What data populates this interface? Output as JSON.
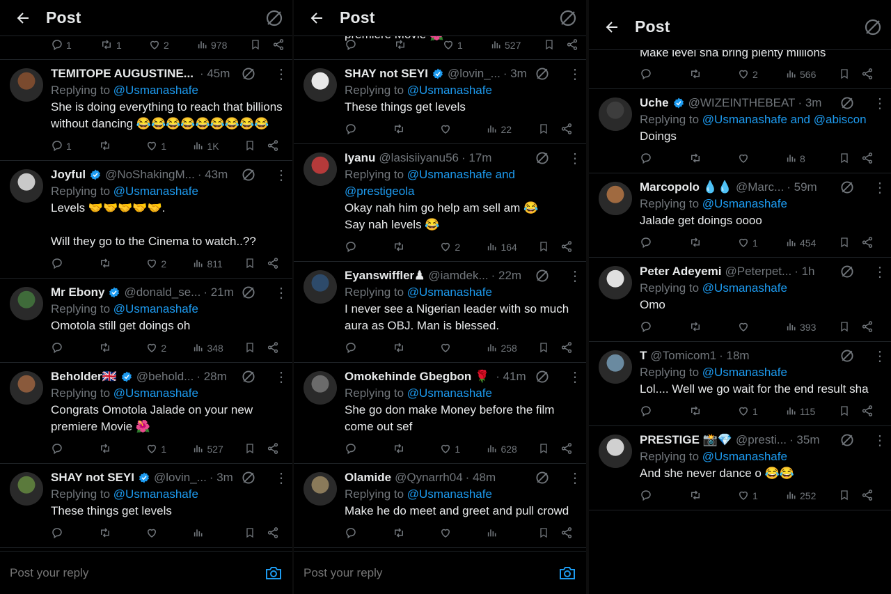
{
  "header": {
    "title": "Post"
  },
  "compose": {
    "placeholder": "Post your reply"
  },
  "colors": {
    "background": "#000000",
    "text": "#e7e9ea",
    "muted": "#71767b",
    "accent": "#1d9bf0"
  },
  "panels": [
    {
      "tail": {
        "text": "",
        "reply": "1",
        "retweets": "1",
        "likes": "2",
        "views": "978"
      },
      "tweets": [
        {
          "name": "TEMITOPE AUGUSTINE...",
          "verified": false,
          "handle": "",
          "time": "· 45m",
          "replying": "Replying to ",
          "mention": "@Usmanashafe",
          "text": "She is doing everything to reach that billions without dancing 😂😂😂😂😂😂😂😂😂",
          "reply": "1",
          "retweets": "",
          "likes": "1",
          "views": "1K"
        },
        {
          "name": "Joyful",
          "verified": true,
          "handle": "@NoShakingM...",
          "time": "· 43m",
          "replying": "Replying to ",
          "mention": "@Usmanashafe",
          "text": "Levels 🤝🤝🤝🤝🤝.\n\nWill they go to the Cinema to watch..??",
          "reply": "",
          "retweets": "",
          "likes": "2",
          "views": "811"
        },
        {
          "name": "Mr Ebony",
          "verified": true,
          "handle": "@donald_se...",
          "time": "· 21m",
          "replying": "Replying to ",
          "mention": "@Usmanashafe",
          "text": "Omotola still get doings oh",
          "reply": "",
          "retweets": "",
          "likes": "2",
          "views": "348"
        },
        {
          "name": "Beholder🇬🇧",
          "verified": true,
          "handle": "@behold...",
          "time": "· 28m",
          "replying": "Replying to ",
          "mention": "@Usmanashafe",
          "text": "Congrats Omotola Jalade on your new premiere Movie 🌺",
          "reply": "",
          "retweets": "",
          "likes": "1",
          "views": "527"
        },
        {
          "name": "SHAY not SEYI",
          "verified": true,
          "handle": "@lovin_...",
          "time": "· 3m",
          "replying": "Replying to ",
          "mention": "@Usmanashafe",
          "text": "These things get levels",
          "reply": "",
          "retweets": "",
          "likes": "",
          "views": ""
        }
      ]
    },
    {
      "tail": {
        "text": "premiere Movie 🌺",
        "reply": "",
        "retweets": "",
        "likes": "1",
        "views": "527"
      },
      "tweets": [
        {
          "name": "SHAY not SEYI",
          "verified": true,
          "handle": "@lovin_...",
          "time": "· 3m",
          "replying": "Replying to ",
          "mention": "@Usmanashafe",
          "text": "These things get levels",
          "reply": "",
          "retweets": "",
          "likes": "",
          "views": "22"
        },
        {
          "name": "Iyanu",
          "verified": false,
          "handle": "@lasisiiyanu56",
          "time": "· 17m",
          "replying": "Replying to ",
          "mention": "@Usmanashafe and @prestigeola",
          "text": "Okay nah him go help am sell am 😂\nSay nah levels 😂",
          "reply": "",
          "retweets": "",
          "likes": "2",
          "views": "164"
        },
        {
          "name": "Eyanswiffler♟",
          "verified": false,
          "handle": "@iamdek...",
          "time": "· 22m",
          "replying": "Replying to ",
          "mention": "@Usmanashafe",
          "text": "I never see a Nigerian leader with so much aura as OBJ. Man is blessed.",
          "reply": "",
          "retweets": "",
          "likes": "",
          "views": "258"
        },
        {
          "name": "Omokehinde Gbegbon 🌹",
          "verified": false,
          "handle": "",
          "time": "· 41m",
          "replying": "Replying to ",
          "mention": "@Usmanashafe",
          "text": "She go don make Money before the film come out sef",
          "reply": "",
          "retweets": "",
          "likes": "1",
          "views": "628"
        },
        {
          "name": "Olamide",
          "verified": false,
          "handle": "@Qynarrh04",
          "time": "· 48m",
          "replying": "Replying to ",
          "mention": "@Usmanashafe",
          "text": "Make he do meet and greet and pull crowd",
          "reply": "",
          "retweets": "",
          "likes": "",
          "views": ""
        }
      ]
    },
    {
      "tail": {
        "text": "Make level sha bring plenty millions",
        "reply": "",
        "retweets": "",
        "likes": "2",
        "views": "566"
      },
      "tweets": [
        {
          "name": "Uche",
          "verified": true,
          "handle": "@WIZEINTHEBEAT",
          "time": "· 3m",
          "replying": "Replying to ",
          "mention": "@Usmanashafe and @abiscon",
          "text": "Doings",
          "reply": "",
          "retweets": "",
          "likes": "",
          "views": "8"
        },
        {
          "name": "Marcopolo 💧💧",
          "verified": false,
          "handle": "@Marc...",
          "time": "· 59m",
          "replying": "Replying to ",
          "mention": "@Usmanashafe",
          "text": "Jalade get doings oooo",
          "reply": "",
          "retweets": "",
          "likes": "1",
          "views": "454"
        },
        {
          "name": "Peter Adeyemi",
          "verified": false,
          "handle": "@Peterpet...",
          "time": "· 1h",
          "replying": "Replying to ",
          "mention": "@Usmanashafe",
          "text": "Omo",
          "reply": "",
          "retweets": "",
          "likes": "",
          "views": "393"
        },
        {
          "name": "T",
          "verified": false,
          "handle": "@Tomicom1",
          "time": "· 18m",
          "replying": "Replying to ",
          "mention": "@Usmanashafe",
          "text": "Lol.... Well we go wait for the end result sha",
          "reply": "",
          "retweets": "",
          "likes": "1",
          "views": "115"
        },
        {
          "name": "PRESTIGE 📸💎",
          "verified": false,
          "handle": "@presti...",
          "time": "· 35m",
          "replying": "Replying to ",
          "mention": "@Usmanashafe",
          "text": "And she never dance o 😂😂",
          "reply": "",
          "retweets": "",
          "likes": "1",
          "views": "252"
        }
      ]
    }
  ],
  "icons": {
    "back": "arrow-left-icon",
    "grok": "grok-icon",
    "reply": "reply-icon",
    "retweet": "retweet-icon",
    "like": "heart-icon",
    "views": "views-icon",
    "bookmark": "bookmark-icon",
    "share": "share-icon",
    "camera": "camera-icon",
    "verified": "verified-badge-icon",
    "more": "more-icon"
  }
}
